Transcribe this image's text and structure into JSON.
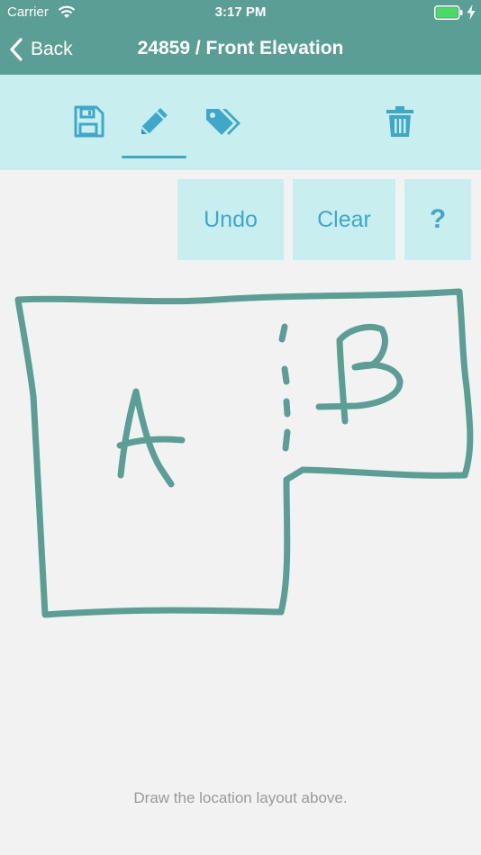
{
  "status_bar": {
    "carrier": "Carrier",
    "time": "3:17 PM",
    "battery_color": "#4cd964"
  },
  "nav": {
    "back_label": "Back",
    "title": "24859 / Front Elevation"
  },
  "toolbar": {
    "tools": [
      "save-icon",
      "pencil-icon",
      "tags-icon",
      "trash-icon"
    ],
    "selected_tool": "pencil-icon",
    "accent_color": "#3fa8c8"
  },
  "actions": {
    "undo_label": "Undo",
    "clear_label": "Clear",
    "help_label": "?"
  },
  "canvas": {
    "label_a": "A",
    "label_b": "B",
    "stroke_color": "#5b9e96",
    "hint": "Draw the location layout above."
  }
}
